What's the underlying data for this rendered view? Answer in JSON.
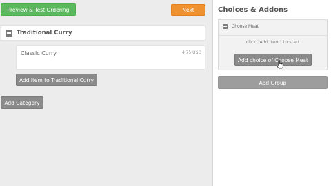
{
  "toolbar": {
    "preview_label": "Preview & Test Ordering",
    "next_label": "Next"
  },
  "menu": {
    "category_title": "Traditional Curry",
    "item": {
      "name": "Classic Curry",
      "price": "4.75 USD"
    },
    "add_item_label": "Add item to Traditional Curry",
    "add_category_label": "Add Category"
  },
  "panel": {
    "title": "Choices & Addons",
    "group_name": "Choose Meat",
    "hint": "click \"Add item\" to start",
    "add_choice_label": "Add choice of Choose Meat",
    "add_group_label": "Add Group"
  },
  "colors": {
    "green": "#5cb85c",
    "orange": "#f0912f",
    "gray_button": "#8a8a8a"
  }
}
